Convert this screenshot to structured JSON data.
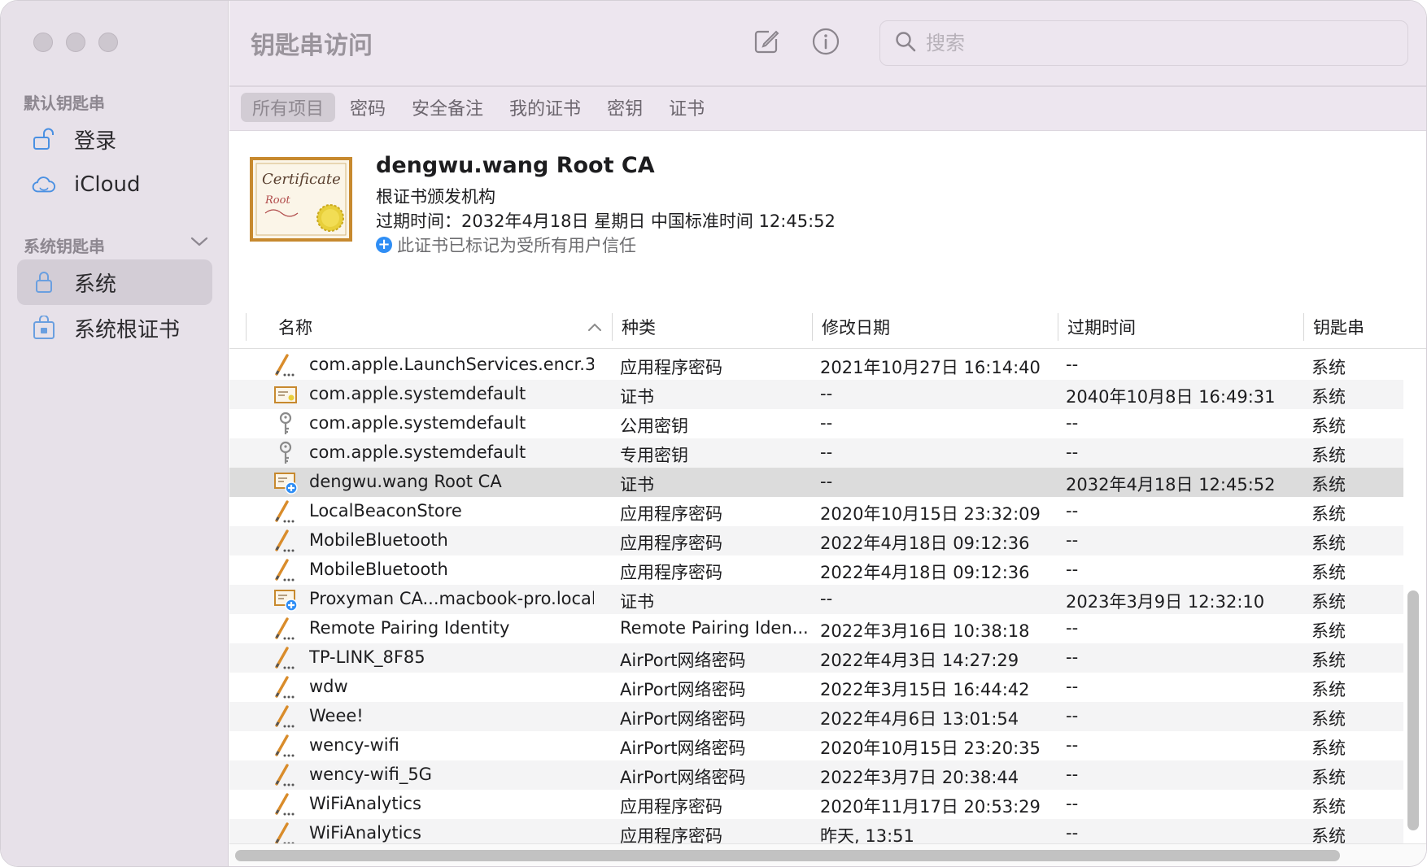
{
  "sidebar": {
    "default_section": "默认钥匙串",
    "system_section": "系统钥匙串",
    "items": [
      {
        "label": "登录",
        "icon": "unlock-icon"
      },
      {
        "label": "iCloud",
        "icon": "cloud-icon"
      },
      {
        "label": "系统",
        "icon": "lock-icon",
        "selected": true
      },
      {
        "label": "系统根证书",
        "icon": "locked-cabinet-icon"
      }
    ]
  },
  "toolbar": {
    "title": "钥匙串访问",
    "search_placeholder": "搜索",
    "tabs": [
      "所有项目",
      "密码",
      "安全备注",
      "我的证书",
      "密钥",
      "证书"
    ],
    "active_tab": 0
  },
  "detail": {
    "name": "dengwu.wang Root CA",
    "kind": "根证书颁发机构",
    "expires": "过期时间：2032年4月18日 星期日 中国标准时间 12:45:52",
    "trust": "此证书已标记为受所有用户信任"
  },
  "table": {
    "columns": [
      "名称",
      "种类",
      "修改日期",
      "过期时间",
      "钥匙串"
    ],
    "rows": [
      {
        "icon": "password-icon",
        "name": "com.apple.LaunchServices.encr.3",
        "kind": "应用程序密码",
        "modified": "2021年10月27日 16:14:40",
        "expires": "--",
        "keychain": "系统"
      },
      {
        "icon": "certificate-icon",
        "name": "com.apple.systemdefault",
        "kind": "证书",
        "modified": "--",
        "expires": "2040年10月8日 16:49:31",
        "keychain": "系统"
      },
      {
        "icon": "key-icon",
        "name": "com.apple.systemdefault",
        "kind": "公用密钥",
        "modified": "--",
        "expires": "--",
        "keychain": "系统"
      },
      {
        "icon": "key-icon",
        "name": "com.apple.systemdefault",
        "kind": "专用密钥",
        "modified": "--",
        "expires": "--",
        "keychain": "系统"
      },
      {
        "icon": "trusted-certificate-icon",
        "name": "dengwu.wang Root CA",
        "kind": "证书",
        "modified": "--",
        "expires": "2032年4月18日 12:45:52",
        "keychain": "系统",
        "selected": true
      },
      {
        "icon": "password-icon",
        "name": "LocalBeaconStore",
        "kind": "应用程序密码",
        "modified": "2020年10月15日 23:32:09",
        "expires": "--",
        "keychain": "系统"
      },
      {
        "icon": "password-icon",
        "name": "MobileBluetooth",
        "kind": "应用程序密码",
        "modified": "2022年4月18日 09:12:36",
        "expires": "--",
        "keychain": "系统"
      },
      {
        "icon": "password-icon",
        "name": "MobileBluetooth",
        "kind": "应用程序密码",
        "modified": "2022年4月18日 09:12:36",
        "expires": "--",
        "keychain": "系统"
      },
      {
        "icon": "trusted-certificate-icon",
        "name": "Proxyman CA...macbook-pro.local)",
        "kind": "证书",
        "modified": "--",
        "expires": "2023年3月9日 12:32:10",
        "keychain": "系统"
      },
      {
        "icon": "password-icon",
        "name": "Remote Pairing Identity",
        "kind": "Remote Pairing Iden...",
        "modified": "2022年3月16日 10:38:18",
        "expires": "--",
        "keychain": "系统"
      },
      {
        "icon": "password-icon",
        "name": "TP-LINK_8F85",
        "kind": "AirPort网络密码",
        "modified": "2022年4月3日 14:27:29",
        "expires": "--",
        "keychain": "系统"
      },
      {
        "icon": "password-icon",
        "name": "wdw",
        "kind": "AirPort网络密码",
        "modified": "2022年3月15日 16:44:42",
        "expires": "--",
        "keychain": "系统"
      },
      {
        "icon": "password-icon",
        "name": "Weee!",
        "kind": "AirPort网络密码",
        "modified": "2022年4月6日 13:01:54",
        "expires": "--",
        "keychain": "系统"
      },
      {
        "icon": "password-icon",
        "name": "wency-wifi",
        "kind": "AirPort网络密码",
        "modified": "2020年10月15日 23:20:35",
        "expires": "--",
        "keychain": "系统"
      },
      {
        "icon": "password-icon",
        "name": "wency-wifi_5G",
        "kind": "AirPort网络密码",
        "modified": "2022年3月7日 20:38:44",
        "expires": "--",
        "keychain": "系统"
      },
      {
        "icon": "password-icon",
        "name": "WiFiAnalytics",
        "kind": "应用程序密码",
        "modified": "2020年11月17日 20:53:29",
        "expires": "--",
        "keychain": "系统"
      },
      {
        "icon": "password-icon",
        "name": "WiFiAnalytics",
        "kind": "应用程序密码",
        "modified": "昨天, 13:51",
        "expires": "--",
        "keychain": "系统"
      }
    ]
  }
}
